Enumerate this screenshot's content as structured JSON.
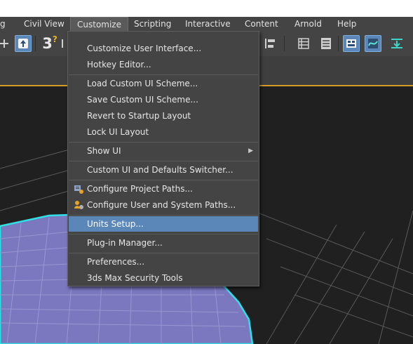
{
  "menubar": {
    "items": [
      {
        "label": "g",
        "key": "g"
      },
      {
        "label": "Civil View",
        "key": "civil"
      },
      {
        "label": "Customize",
        "key": "customize",
        "active": true
      },
      {
        "label": "Scripting",
        "key": "scripting"
      },
      {
        "label": "Interactive",
        "key": "interactive"
      },
      {
        "label": "Content",
        "key": "content"
      },
      {
        "label": "Arnold",
        "key": "arnold"
      },
      {
        "label": "Help",
        "key": "help"
      }
    ]
  },
  "toolbar": {
    "snap_label": "3",
    "snap_superscript": "?",
    "icons": [
      "snap-toggle-icon",
      "select-object-icon",
      "snaps-toggle-icon",
      "align-icon",
      "layer-explorer-icon",
      "scene-explorer-icon",
      "toggle-ribbon-icon",
      "curve-editor-icon",
      "render-setup-icon"
    ]
  },
  "menu": {
    "title": "Customize",
    "items": [
      {
        "label": "Customize User Interface...",
        "underline": "C",
        "name": "customize-user-interface"
      },
      {
        "label": "Hotkey Editor...",
        "underline": "",
        "name": "hotkey-editor"
      },
      {
        "label": "Load Custom UI Scheme...",
        "underline": "",
        "name": "load-custom-ui-scheme"
      },
      {
        "label": "Save Custom UI Scheme...",
        "underline": "",
        "name": "save-custom-ui-scheme"
      },
      {
        "label": "Revert to Startup Layout",
        "underline": "R",
        "name": "revert-to-startup-layout"
      },
      {
        "label": "Lock UI Layout",
        "underline": "k",
        "name": "lock-ui-layout"
      },
      {
        "label": "Show UI",
        "underline": "h",
        "name": "show-ui",
        "submenu": true
      },
      {
        "label": "Custom UI and Defaults Switcher...",
        "underline": "",
        "name": "custom-ui-defaults-switcher"
      },
      {
        "label": "Configure Project Paths...",
        "underline": "C",
        "name": "configure-project-paths",
        "icon": "project-paths-icon"
      },
      {
        "label": "Configure User and System Paths...",
        "underline": "C",
        "name": "configure-user-system-paths",
        "icon": "user-paths-icon"
      },
      {
        "label": "Units Setup...",
        "underline": "U",
        "name": "units-setup",
        "selected": true
      },
      {
        "label": "Plug-in Manager...",
        "underline": "",
        "name": "plugin-manager"
      },
      {
        "label": "Preferences...",
        "underline": "P",
        "name": "preferences"
      },
      {
        "label": "3ds Max Security Tools",
        "underline": "",
        "name": "security-tools"
      }
    ]
  },
  "colors": {
    "menu_bg": "#444444",
    "selected_bg": "#5b87b8",
    "viewport_bg": "#202020",
    "object_fill": "#7b78c0",
    "object_edge": "#2fe0e6",
    "ribbon_accent": "#d59b29"
  }
}
